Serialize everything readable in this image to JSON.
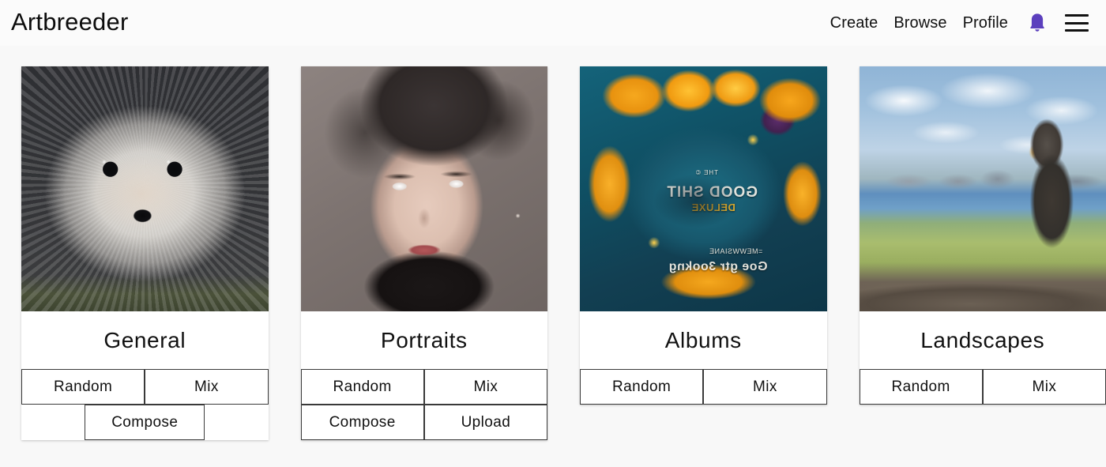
{
  "header": {
    "logo": "Artbreeder",
    "nav": [
      {
        "label": "Create",
        "name": "nav-link-create"
      },
      {
        "label": "Browse",
        "name": "nav-link-browse"
      },
      {
        "label": "Profile",
        "name": "nav-link-profile"
      }
    ],
    "notification_icon": "bell-icon",
    "menu_icon": "hamburger-menu-icon",
    "accent_color": "#5b3fbd",
    "background_color": "#fbfbfb"
  },
  "page": {
    "background_color": "#f8f8f8",
    "text_color": "#111111",
    "card_background": "#ffffff",
    "button_border_color": "#3a3a3a"
  },
  "cards": [
    {
      "title": "General",
      "thumb_alt": "fluffy white dog portrait",
      "rows": [
        [
          {
            "label": "Random"
          },
          {
            "label": "Mix"
          }
        ],
        [
          {
            "label": "Compose"
          }
        ]
      ]
    },
    {
      "title": "Portraits",
      "thumb_alt": "stylized portrait of a woman with dark hair",
      "rows": [
        [
          {
            "label": "Random"
          },
          {
            "label": "Mix"
          }
        ],
        [
          {
            "label": "Compose"
          },
          {
            "label": "Upload"
          }
        ]
      ]
    },
    {
      "title": "Albums",
      "thumb_alt": "abstract teal and gold album cover art",
      "rows": [
        [
          {
            "label": "Random"
          },
          {
            "label": "Mix"
          }
        ]
      ]
    },
    {
      "title": "Landscapes",
      "thumb_alt": "painted lake landscape with figure on rocks",
      "rows": [
        [
          {
            "label": "Random"
          },
          {
            "label": "Mix"
          }
        ]
      ]
    }
  ],
  "album_art_text": {
    "line1": "THE ©",
    "line2": "GOOD SHIT",
    "line3": "DELUXE",
    "line4": "=MEWWSIANE",
    "line5": "Goe gtr 3ookng"
  }
}
